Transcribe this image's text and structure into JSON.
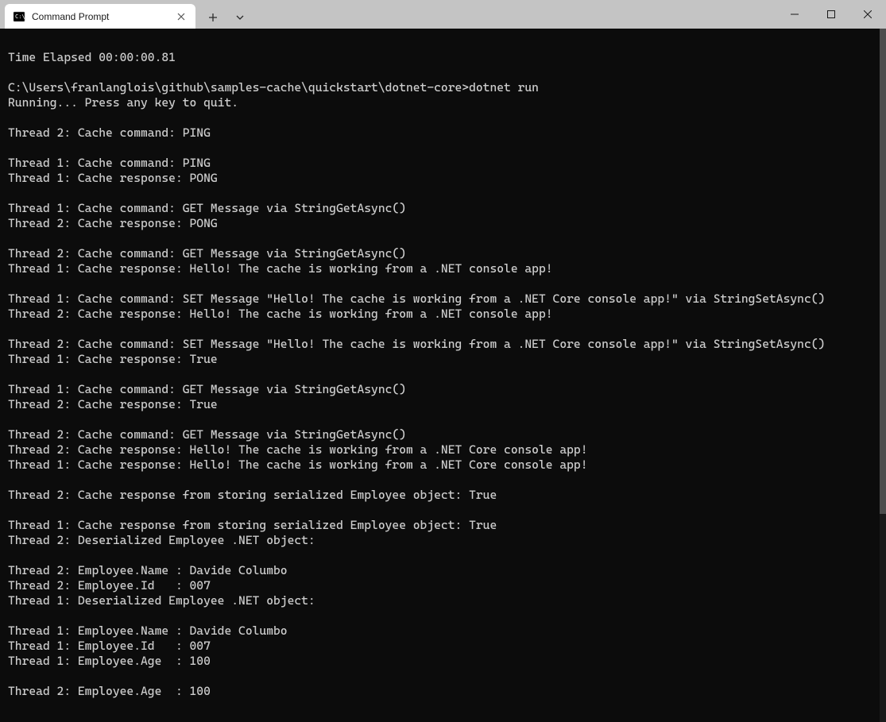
{
  "window": {
    "tab_title": "Command Prompt"
  },
  "terminal": {
    "lines": [
      "",
      "Time Elapsed 00:00:00.81",
      "",
      "C:\\Users\\franlanglois\\github\\samples-cache\\quickstart\\dotnet-core>dotnet run",
      "Running... Press any key to quit.",
      "",
      "Thread 2: Cache command: PING",
      "",
      "Thread 1: Cache command: PING",
      "Thread 1: Cache response: PONG",
      "",
      "Thread 1: Cache command: GET Message via StringGetAsync()",
      "Thread 2: Cache response: PONG",
      "",
      "Thread 2: Cache command: GET Message via StringGetAsync()",
      "Thread 1: Cache response: Hello! The cache is working from a .NET console app!",
      "",
      "Thread 1: Cache command: SET Message \"Hello! The cache is working from a .NET Core console app!\" via StringSetAsync()",
      "Thread 2: Cache response: Hello! The cache is working from a .NET console app!",
      "",
      "Thread 2: Cache command: SET Message \"Hello! The cache is working from a .NET Core console app!\" via StringSetAsync()",
      "Thread 1: Cache response: True",
      "",
      "Thread 1: Cache command: GET Message via StringGetAsync()",
      "Thread 2: Cache response: True",
      "",
      "Thread 2: Cache command: GET Message via StringGetAsync()",
      "Thread 2: Cache response: Hello! The cache is working from a .NET Core console app!",
      "Thread 1: Cache response: Hello! The cache is working from a .NET Core console app!",
      "",
      "Thread 2: Cache response from storing serialized Employee object: True",
      "",
      "Thread 1: Cache response from storing serialized Employee object: True",
      "Thread 2: Deserialized Employee .NET object:",
      "",
      "Thread 2: Employee.Name : Davide Columbo",
      "Thread 2: Employee.Id   : 007",
      "Thread 1: Deserialized Employee .NET object:",
      "",
      "Thread 1: Employee.Name : Davide Columbo",
      "Thread 1: Employee.Id   : 007",
      "Thread 1: Employee.Age  : 100",
      "",
      "Thread 2: Employee.Age  : 100",
      ""
    ]
  }
}
